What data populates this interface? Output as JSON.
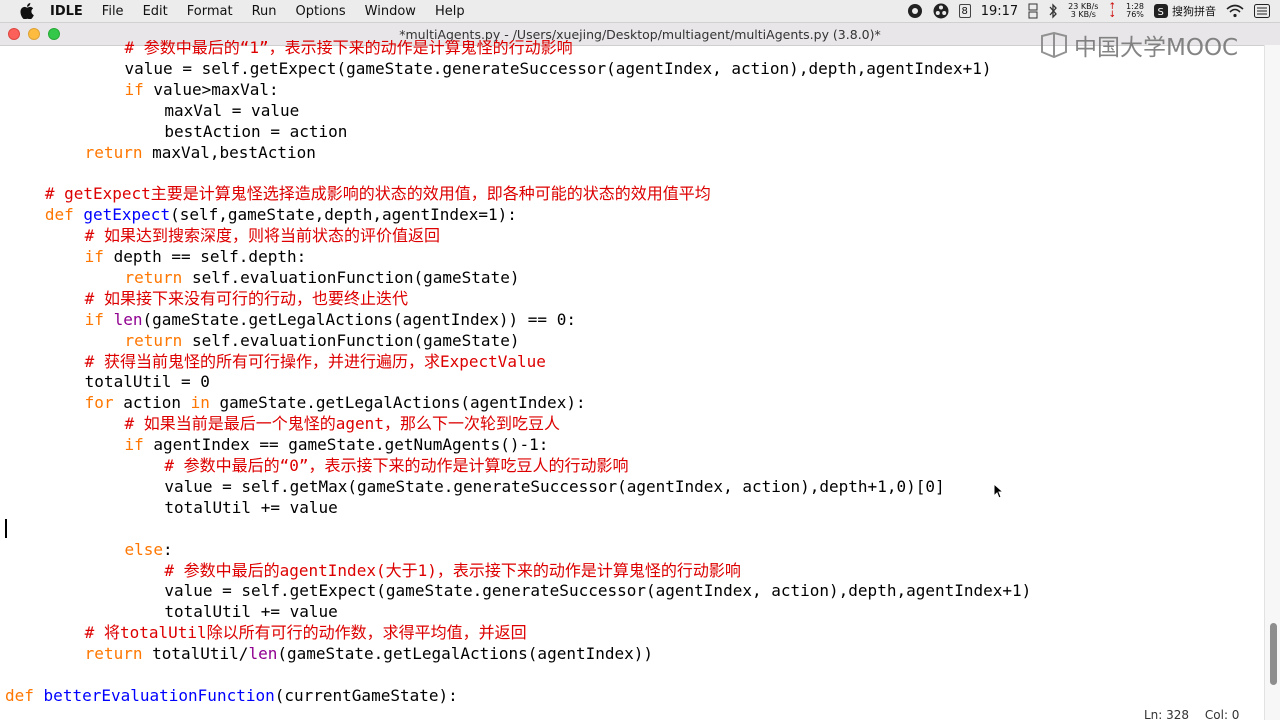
{
  "menubar": {
    "app": "IDLE",
    "items": [
      "File",
      "Edit",
      "Format",
      "Run",
      "Options",
      "Window",
      "Help"
    ],
    "status": {
      "calendar_day": "8",
      "time": "19:17",
      "net_up": "23 KB/s",
      "net_down": "3 KB/s",
      "battery_time": "1:28",
      "battery_pct": "76%",
      "ime": "搜狗拼音"
    }
  },
  "window": {
    "title": "*multiAgents.py - /Users/xuejing/Desktop/multiagent/multiAgents.py (3.8.0)*"
  },
  "watermark": "中国大学MOOC",
  "editor": {
    "lines": [
      {
        "indent": 12,
        "tokens": [
          {
            "t": "# 参数中最后的“1”，表示接下来的动作是计算鬼怪的行动影响",
            "c": "cm"
          }
        ]
      },
      {
        "indent": 12,
        "tokens": [
          {
            "t": "value = self.getExpect(gameState.generateSuccessor(agentIndex, action),depth,agentIndex+1)",
            "c": ""
          }
        ]
      },
      {
        "indent": 12,
        "tokens": [
          {
            "t": "if",
            "c": "kw"
          },
          {
            "t": " value>maxVal:",
            "c": ""
          }
        ]
      },
      {
        "indent": 16,
        "tokens": [
          {
            "t": "maxVal = value",
            "c": ""
          }
        ]
      },
      {
        "indent": 16,
        "tokens": [
          {
            "t": "bestAction = action",
            "c": ""
          }
        ]
      },
      {
        "indent": 8,
        "tokens": [
          {
            "t": "return",
            "c": "kw"
          },
          {
            "t": " maxVal,bestAction",
            "c": ""
          }
        ]
      },
      {
        "indent": 0,
        "tokens": []
      },
      {
        "indent": 4,
        "tokens": [
          {
            "t": "# getExpect主要是计算鬼怪选择造成影响的状态的效用值，即各种可能的状态的效用值平均",
            "c": "cm"
          }
        ]
      },
      {
        "indent": 4,
        "tokens": [
          {
            "t": "def",
            "c": "kw"
          },
          {
            "t": " ",
            "c": ""
          },
          {
            "t": "getExpect",
            "c": "df"
          },
          {
            "t": "(self,gameState,depth,agentIndex=1):",
            "c": ""
          }
        ]
      },
      {
        "indent": 8,
        "tokens": [
          {
            "t": "# 如果达到搜索深度，则将当前状态的评价值返回",
            "c": "cm"
          }
        ]
      },
      {
        "indent": 8,
        "tokens": [
          {
            "t": "if",
            "c": "kw"
          },
          {
            "t": " depth == self.depth:",
            "c": ""
          }
        ]
      },
      {
        "indent": 12,
        "tokens": [
          {
            "t": "return",
            "c": "kw"
          },
          {
            "t": " self.evaluationFunction(gameState)",
            "c": ""
          }
        ]
      },
      {
        "indent": 8,
        "tokens": [
          {
            "t": "# 如果接下来没有可行的行动，也要终止迭代",
            "c": "cm"
          }
        ]
      },
      {
        "indent": 8,
        "tokens": [
          {
            "t": "if",
            "c": "kw"
          },
          {
            "t": " ",
            "c": ""
          },
          {
            "t": "len",
            "c": "bi"
          },
          {
            "t": "(gameState.getLegalActions(agentIndex)) == 0:",
            "c": ""
          }
        ]
      },
      {
        "indent": 12,
        "tokens": [
          {
            "t": "return",
            "c": "kw"
          },
          {
            "t": " self.evaluationFunction(gameState)",
            "c": ""
          }
        ]
      },
      {
        "indent": 8,
        "tokens": [
          {
            "t": "# 获得当前鬼怪的所有可行操作，并进行遍历，求ExpectValue",
            "c": "cm"
          }
        ]
      },
      {
        "indent": 8,
        "tokens": [
          {
            "t": "totalUtil = 0",
            "c": ""
          }
        ]
      },
      {
        "indent": 8,
        "tokens": [
          {
            "t": "for",
            "c": "kw"
          },
          {
            "t": " action ",
            "c": ""
          },
          {
            "t": "in",
            "c": "kw"
          },
          {
            "t": " gameState.getLegalActions(agentIndex):",
            "c": ""
          }
        ]
      },
      {
        "indent": 12,
        "tokens": [
          {
            "t": "# 如果当前是最后一个鬼怪的agent，那么下一次轮到吃豆人",
            "c": "cm"
          }
        ]
      },
      {
        "indent": 12,
        "tokens": [
          {
            "t": "if",
            "c": "kw"
          },
          {
            "t": " agentIndex == gameState.getNumAgents()-1:",
            "c": ""
          }
        ]
      },
      {
        "indent": 16,
        "tokens": [
          {
            "t": "# 参数中最后的“0”，表示接下来的动作是计算吃豆人的行动影响",
            "c": "cm"
          }
        ]
      },
      {
        "indent": 16,
        "tokens": [
          {
            "t": "value = self.getMax(gameState.generateSuccessor(agentIndex, action),depth+1,0)[0]",
            "c": ""
          }
        ]
      },
      {
        "indent": 16,
        "tokens": [
          {
            "t": "totalUtil += value",
            "c": ""
          }
        ]
      },
      {
        "indent": 0,
        "tokens": []
      },
      {
        "indent": 12,
        "tokens": [
          {
            "t": "else",
            "c": "kw"
          },
          {
            "t": ":",
            "c": ""
          }
        ]
      },
      {
        "indent": 16,
        "tokens": [
          {
            "t": "# 参数中最后的agentIndex(大于1)，表示接下来的动作是计算鬼怪的行动影响",
            "c": "cm"
          }
        ]
      },
      {
        "indent": 16,
        "tokens": [
          {
            "t": "value = self.getExpect(gameState.generateSuccessor(agentIndex, action),depth,agentIndex+1)",
            "c": ""
          }
        ]
      },
      {
        "indent": 16,
        "tokens": [
          {
            "t": "totalUtil += value",
            "c": ""
          }
        ]
      },
      {
        "indent": 8,
        "tokens": [
          {
            "t": "# 将totalUtil除以所有可行的动作数，求得平均值，并返回",
            "c": "cm"
          }
        ]
      },
      {
        "indent": 8,
        "tokens": [
          {
            "t": "return",
            "c": "kw"
          },
          {
            "t": " totalUtil/",
            "c": ""
          },
          {
            "t": "len",
            "c": "bi"
          },
          {
            "t": "(gameState.getLegalActions(agentIndex))",
            "c": ""
          }
        ]
      },
      {
        "indent": 0,
        "tokens": []
      },
      {
        "indent": 0,
        "tokens": [
          {
            "t": "def",
            "c": "kw"
          },
          {
            "t": " ",
            "c": ""
          },
          {
            "t": "betterEvaluationFunction",
            "c": "df"
          },
          {
            "t": "(currentGameState):",
            "c": ""
          }
        ]
      }
    ]
  },
  "statusbar": {
    "line": "Ln: 328",
    "col": "Col: 0"
  },
  "colors": {
    "keyword": "#ff7700",
    "builtin": "#900090",
    "definition": "#0000ff",
    "comment": "#dd0000"
  }
}
